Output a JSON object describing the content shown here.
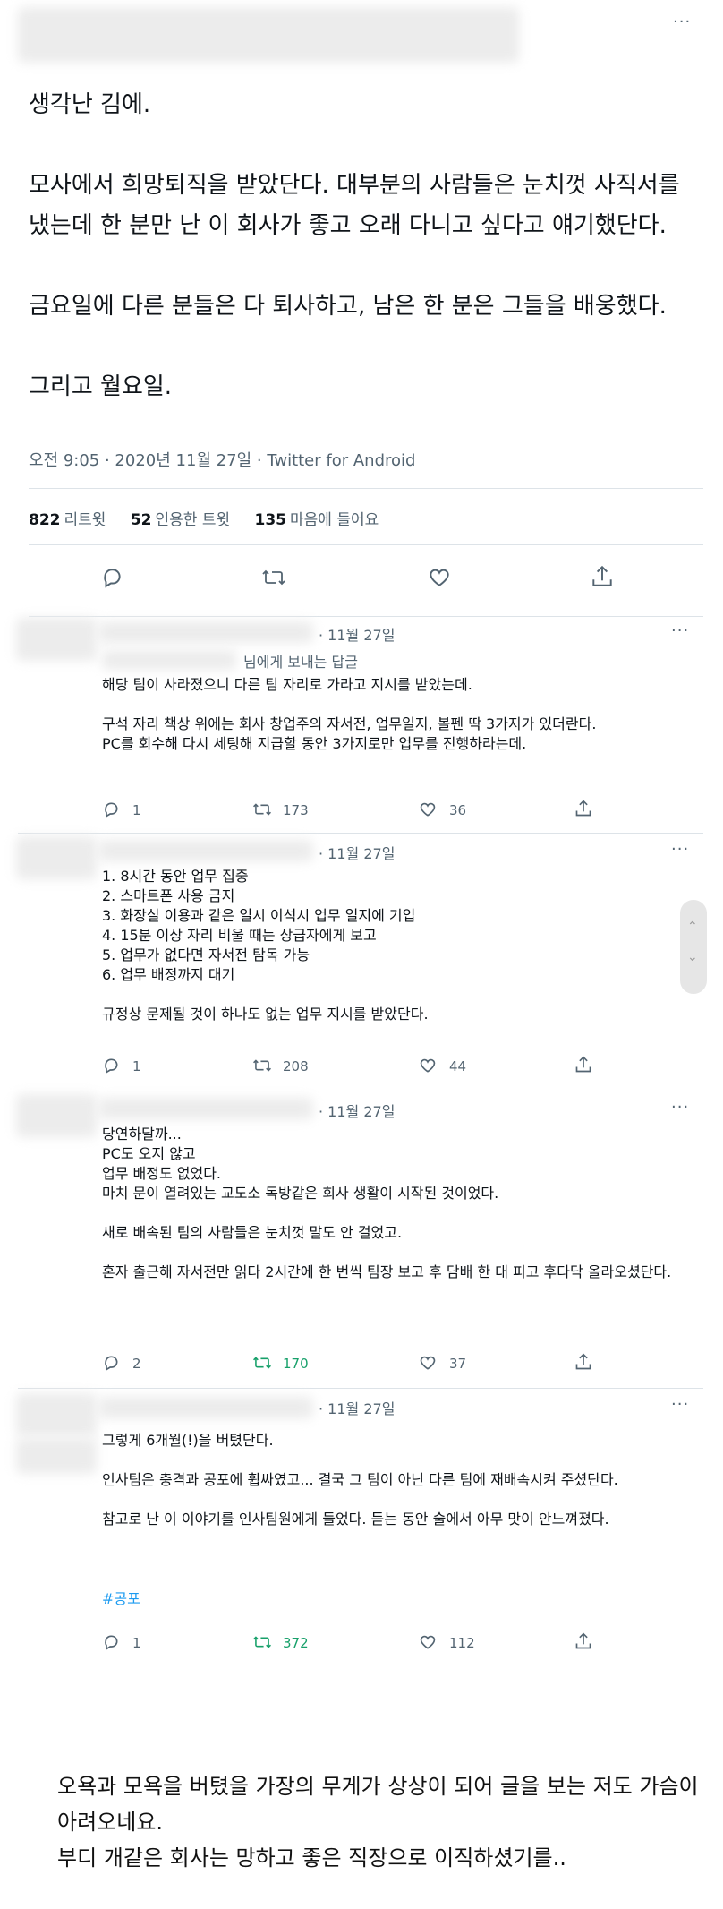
{
  "tweet": {
    "text": "생각난 김에.\n\n모사에서 희망퇴직을 받았단다. 대부분의 사람들은 눈치껏 사직서를 냈는데 한 분만 난 이 회사가 좋고 오래 다니고 싶다고 얘기했단다.\n\n금요일에 다른 분들은 다 퇴사하고, 남은 한 분은 그들을 배웅했다.\n\n그리고 월요일.",
    "meta": "오전 9:05 · 2020년 11월 27일 · Twitter for Android",
    "stats": {
      "retweets_count": "822",
      "retweets_label": "리트윗",
      "quotes_count": "52",
      "quotes_label": "인용한 트윗",
      "likes_count": "135",
      "likes_label": "마음에 들어요"
    },
    "more": "···"
  },
  "replies": [
    {
      "date": "· 11월 27일",
      "replying_to": "님에게 보내는 답글",
      "text": "해당 팀이 사라졌으니 다른 팀 자리로 가라고 지시를 받았는데.\n\n구석 자리 책상 위에는 회사 창업주의 자서전, 업무일지, 볼펜 딱 3가지가 있더란다.\nPC를 회수해 다시 세팅해 지급할 동안 3가지로만 업무를 진행하라는데.",
      "reply_count": "1",
      "retweet_count": "173",
      "like_count": "36",
      "retweeted": false
    },
    {
      "date": "· 11월 27일",
      "text": "1. 8시간 동안 업무 집중\n2. 스마트폰 사용 금지\n3. 화장실 이용과 같은 일시 이석시 업무 일지에 기입\n4. 15분 이상 자리 비울 때는 상급자에게 보고\n5. 업무가 없다면 자서전 탐독 가능\n6. 업무 배정까지 대기\n\n규정상 문제될 것이 하나도 없는 업무 지시를 받았단다.",
      "reply_count": "1",
      "retweet_count": "208",
      "like_count": "44",
      "retweeted": false
    },
    {
      "date": "· 11월 27일",
      "text": "당연하달까...\nPC도 오지 않고\n업무 배정도 없었다.\n마치 문이 열려있는 교도소 독방같은 회사 생활이 시작된 것이었다.\n\n새로 배속된 팀의 사람들은 눈치껏 말도 안 걸었고.\n\n혼자 출근해 자서전만 읽다 2시간에 한 번씩 팀장 보고 후 담배 한 대 피고 후다닥 올라오셨단다.",
      "reply_count": "2",
      "retweet_count": "170",
      "like_count": "37",
      "retweeted": true
    },
    {
      "date": "· 11월 27일",
      "text": "그렇게 6개월(!)을 버텼단다.\n\n인사팀은 충격과 공포에 휩싸였고... 결국 그 팀이 아닌 다른 팀에 재배속시켜 주셨단다.\n\n참고로 난 이 이야기를 인사팀원에게 들었다. 듣는 동안 술에서 아무 맛이 안느껴졌다.",
      "hashtag": "#공포",
      "reply_count": "1",
      "retweet_count": "372",
      "like_count": "112",
      "retweeted": true
    }
  ],
  "bottom_note": "오욕과 모욕을 버텼을 가장의 무게가 상상이 되어 글을 보는 저도 가슴이 아려오네요.\n부디 개같은 회사는 망하고 좋은 직장으로 이직하셨기를..",
  "colors": {
    "text": "#0f1419",
    "secondary": "#536471",
    "retweet_green": "#17a06a",
    "link": "#1d9bf0",
    "divider": "#dde3e8"
  }
}
